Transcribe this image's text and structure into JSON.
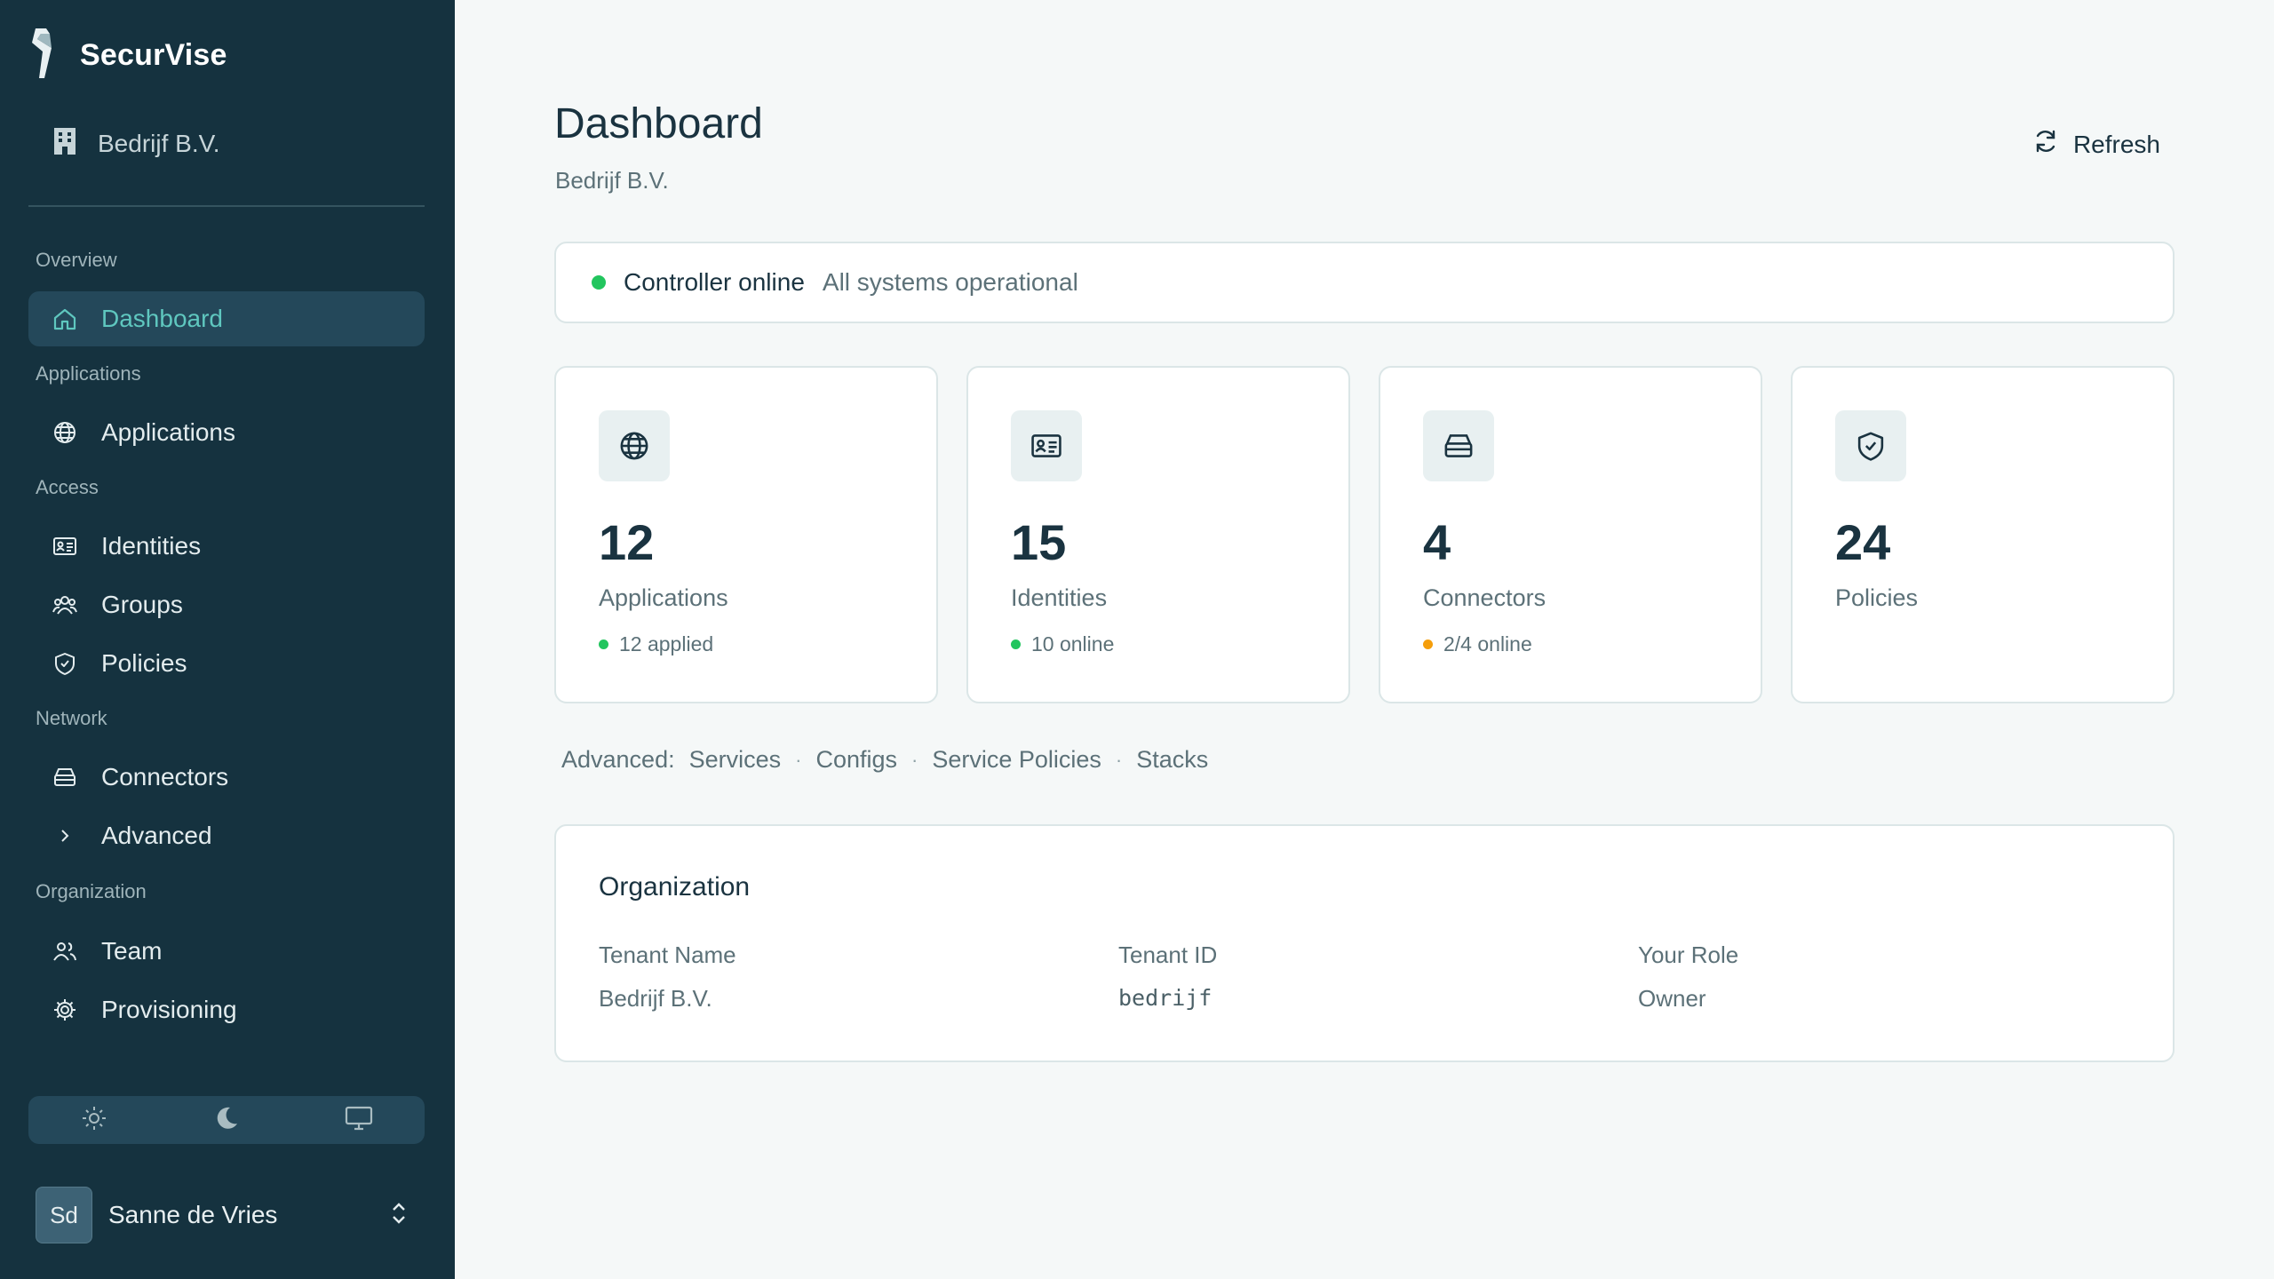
{
  "brand": {
    "name": "SecurVise"
  },
  "sidebar": {
    "tenant": "Bedrijf B.V.",
    "sections": {
      "overview": "Overview",
      "applications": "Applications",
      "access": "Access",
      "network": "Network",
      "organization": "Organization"
    },
    "items": {
      "dashboard": "Dashboard",
      "applications": "Applications",
      "identities": "Identities",
      "groups": "Groups",
      "policies": "Policies",
      "connectors": "Connectors",
      "advanced": "Advanced",
      "team": "Team",
      "provisioning": "Provisioning"
    },
    "active_item": "Dashboard",
    "theme_options": [
      "sun-icon",
      "moon-icon",
      "monitor-icon"
    ],
    "user": {
      "initials": "Sd",
      "name": "Sanne de Vries"
    }
  },
  "header": {
    "title": "Dashboard",
    "subtitle": "Bedrijf B.V.",
    "refresh_label": "Refresh"
  },
  "status": {
    "main": "Controller online",
    "sub": "All systems operational",
    "color": "#22c55e"
  },
  "stats": [
    {
      "icon": "globe-icon",
      "value": "12",
      "label": "Applications",
      "meta": "12 applied",
      "meta_color": "#22c55e"
    },
    {
      "icon": "id-card-icon",
      "value": "15",
      "label": "Identities",
      "meta": "10 online",
      "meta_color": "#22c55e"
    },
    {
      "icon": "server-icon",
      "value": "4",
      "label": "Connectors",
      "meta": "2/4 online",
      "meta_color": "#f59e0b"
    },
    {
      "icon": "shield-check-icon",
      "value": "24",
      "label": "Policies",
      "meta": "",
      "meta_color": ""
    }
  ],
  "advanced": {
    "label": "Advanced:",
    "links": [
      "Services",
      "Configs",
      "Service Policies",
      "Stacks"
    ]
  },
  "organization": {
    "title": "Organization",
    "fields": [
      {
        "key": "Tenant Name",
        "value": "Bedrijf B.V."
      },
      {
        "key": "Tenant ID",
        "value": "bedrijf"
      },
      {
        "key": "Your Role",
        "value": "Owner"
      }
    ]
  },
  "colors": {
    "sidebar_bg": "#15323f",
    "accent": "#5fc7bf",
    "page_bg": "#f5f8f8"
  }
}
